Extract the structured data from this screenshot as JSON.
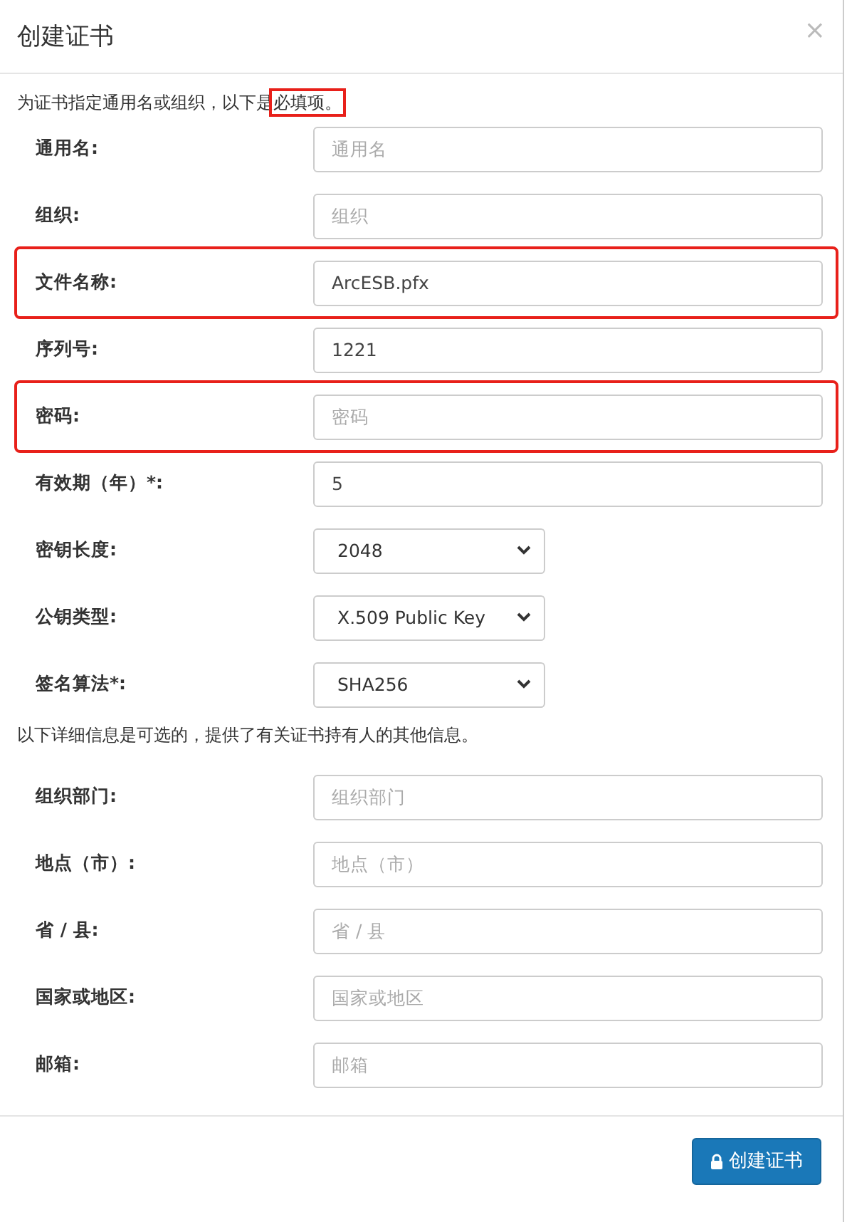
{
  "dialog": {
    "title": "创建证书",
    "close": "×"
  },
  "intro": [
    {
      "text": "为证书指定通用名或组织，以下是",
      "highlighted": false
    },
    {
      "text": "必填项。",
      "highlighted": true
    }
  ],
  "required_fields": [
    {
      "kind": "text",
      "label": "通用名:",
      "placeholder": "通用名",
      "highlighted": false
    },
    {
      "kind": "text",
      "label": "组织:",
      "placeholder": "组织",
      "highlighted": false
    },
    {
      "kind": "text",
      "label": "文件名称:",
      "value": "ArcESB.pfx",
      "highlighted": true
    },
    {
      "kind": "text",
      "label": "序列号:",
      "value": "1221",
      "highlighted": false
    },
    {
      "kind": "text",
      "label": "密码:",
      "placeholder": "密码",
      "highlighted": true
    },
    {
      "kind": "text",
      "label": "有效期（年）*:",
      "value": "5",
      "highlighted": false
    },
    {
      "kind": "select",
      "label": "密钥长度:",
      "value": "2048",
      "highlighted": false
    },
    {
      "kind": "select",
      "label": "公钥类型:",
      "value": "X.509 Public Key",
      "highlighted": false
    },
    {
      "kind": "select",
      "label": "签名算法*:",
      "value": "SHA256",
      "highlighted": false
    }
  ],
  "optional_note": "以下详细信息是可选的，提供了有关证书持有人的其他信息。",
  "optional_fields": [
    {
      "kind": "text",
      "label": "组织部门:",
      "placeholder": "组织部门",
      "highlighted": false
    },
    {
      "kind": "text",
      "label": "地点（市）:",
      "placeholder": "地点（市）",
      "highlighted": false
    },
    {
      "kind": "text",
      "label": "省 / 县:",
      "placeholder": "省 / 县",
      "highlighted": false
    },
    {
      "kind": "text",
      "label": "国家或地区:",
      "placeholder": "国家或地区",
      "highlighted": false
    },
    {
      "kind": "text",
      "label": "邮箱:",
      "placeholder": "邮箱",
      "highlighted": false
    }
  ],
  "submit_button": "创建证书"
}
